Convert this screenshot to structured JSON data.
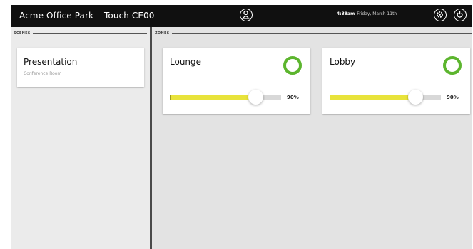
{
  "header": {
    "site_name": "Acme Office Park",
    "panel_name": "Touch CE00",
    "time": "4:38am",
    "date": "Friday, March 11th"
  },
  "scenes": {
    "section_label": "SCENES",
    "items": [
      {
        "title": "Presentation",
        "subtitle": "Conference Room"
      }
    ]
  },
  "zones": {
    "section_label": "ZONES",
    "items": [
      {
        "name": "Lounge",
        "level_label": "90%",
        "level": 0.9
      },
      {
        "name": "Lobby",
        "level_label": "90%",
        "level": 0.9
      }
    ]
  },
  "colors": {
    "topbar": "#101010",
    "power_on": "#5cb52e",
    "slider_fill": "#e8e33b"
  },
  "icons": [
    "user-icon",
    "settings-icon",
    "power-icon"
  ]
}
